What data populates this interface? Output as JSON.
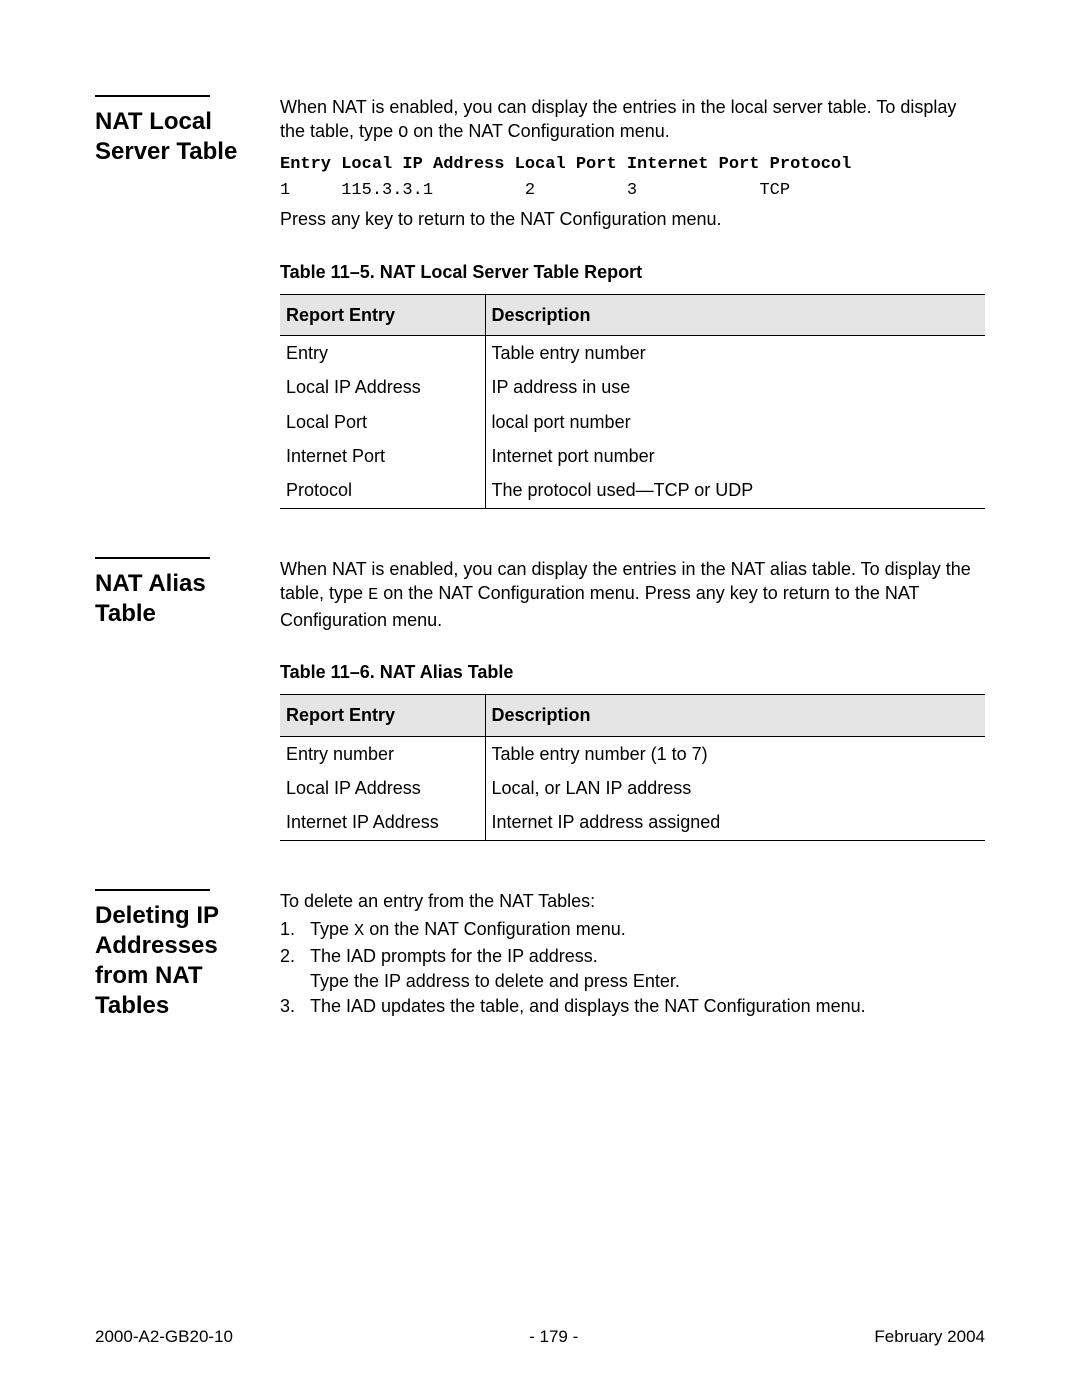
{
  "sections": {
    "natLocal": {
      "heading": "NAT Local Server Table",
      "intro": "When NAT is enabled, you can display the entries in the local server table. To display the table, type ",
      "introKey": "O",
      "introTail": " on the NAT Configuration menu.",
      "monoHeader": "Entry Local IP Address Local Port Internet Port Protocol",
      "monoRow": "1     115.3.3.1         2         3            TCP",
      "postMono": "Press any key to return to the NAT Configuration menu.",
      "tableCaption": "Table 11–5. NAT Local Server Table Report",
      "th1": "Report Entry",
      "th2": "Description",
      "rows": [
        {
          "entry": "Entry",
          "desc": "Table entry number"
        },
        {
          "entry": "Local IP Address",
          "desc": "IP address in use"
        },
        {
          "entry": "Local Port",
          "desc": "local port number"
        },
        {
          "entry": "Internet Port",
          "desc": "Internet port number"
        },
        {
          "entry": "Protocol",
          "desc": "The protocol used—TCP or UDP"
        }
      ]
    },
    "natAlias": {
      "heading": "NAT Alias Table",
      "intro": "When NAT is enabled, you can display the entries in the NAT alias table. To display the table, type ",
      "introKey": "E",
      "introTail": " on the NAT Configuration menu. Press any key to return to the NAT Configuration menu.",
      "tableCaption": "Table 11–6. NAT Alias Table",
      "th1": "Report Entry",
      "th2": "Description",
      "rows": [
        {
          "entry": "Entry number",
          "desc": "Table entry number (1 to 7)"
        },
        {
          "entry": "Local IP Address",
          "desc": "Local, or LAN IP address"
        },
        {
          "entry": "Internet IP Address",
          "desc": "Internet IP address assigned"
        }
      ]
    },
    "deleting": {
      "heading": "Deleting IP Addresses from NAT Tables",
      "intro": "To delete an entry from the NAT Tables:",
      "step1a": "Type ",
      "step1key": "X",
      "step1b": " on the NAT Configuration menu.",
      "step2a": "The IAD prompts for the IP address.",
      "step2b": "Type the IP address to delete and press Enter.",
      "step3": "The IAD updates the table, and displays the NAT Configuration menu."
    }
  },
  "footer": {
    "left": "2000-A2-GB20-10",
    "center": "- 179 -",
    "right": "February 2004"
  }
}
